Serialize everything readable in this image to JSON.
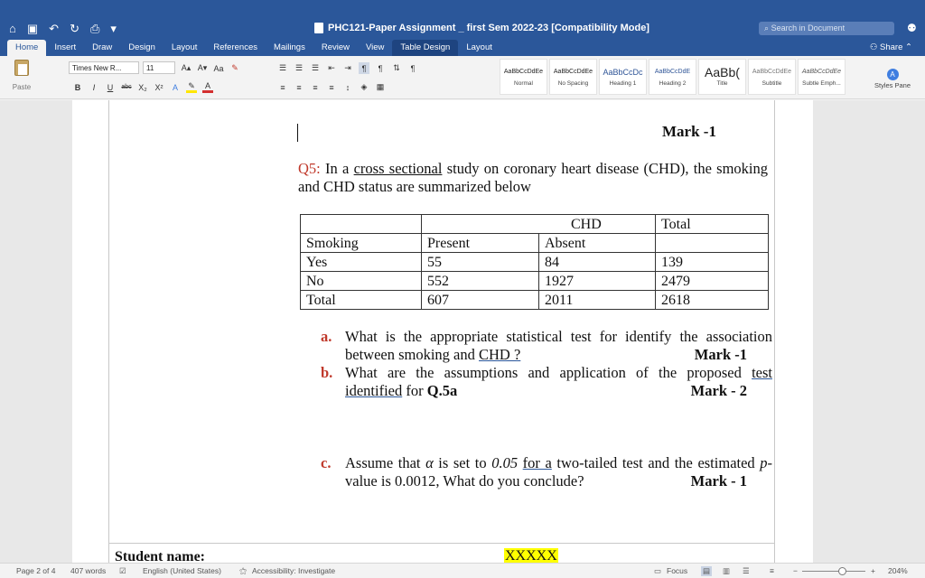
{
  "window": {
    "title": "PHC121-Paper Assignment _ first Sem 2022-23 [Compatibility Mode]",
    "search_placeholder": "Search in Document",
    "toolbar_icons": [
      "home-icon",
      "save-icon",
      "undo-icon",
      "redo-icon",
      "print-icon",
      "customize-icon"
    ]
  },
  "tabs": [
    "Home",
    "Insert",
    "Draw",
    "Design",
    "Layout",
    "References",
    "Mailings",
    "Review",
    "View",
    "Table Design",
    "Layout"
  ],
  "share_label": "Share",
  "ribbon": {
    "paste_label": "Paste",
    "font_name": "Times New R...",
    "font_size": "11",
    "styles": [
      {
        "sample": "AaBbCcDdEe",
        "name": "Normal"
      },
      {
        "sample": "AaBbCcDdEe",
        "name": "No Spacing"
      },
      {
        "sample": "AaBbCcDc",
        "name": "Heading 1"
      },
      {
        "sample": "AaBbCcDdE",
        "name": "Heading 2"
      },
      {
        "sample": "AaBb(",
        "name": "Title"
      },
      {
        "sample": "AaBbCcDdEe",
        "name": "Subtitle"
      },
      {
        "sample": "AaBbCcDdEe",
        "name": "Subtle Emph..."
      }
    ],
    "styles_pane_label": "Styles Pane"
  },
  "document": {
    "mark_top": "Mark -1",
    "q5_label": "Q5:",
    "q5_part1": " In a ",
    "q5_underlined": "cross sectional",
    "q5_part2": " study on coronary heart disease (CHD), the smoking and CHD status are summarized below",
    "table": {
      "header_chd": "CHD",
      "header_total": "Total",
      "col_smoking": "Smoking",
      "col_present": "Present",
      "col_absent": "Absent",
      "rows": [
        {
          "label": "Yes",
          "present": "55",
          "absent": "84",
          "total": "139"
        },
        {
          "label": "No",
          "present": "552",
          "absent": "1927",
          "total": "2479"
        },
        {
          "label": "Total",
          "present": "607",
          "absent": "2011",
          "total": "2618"
        }
      ]
    },
    "qa": {
      "letter": "a.",
      "text1": "What is the appropriate statistical test for identify the association between smoking and ",
      "text_ul": "CHD ?",
      "mark": "Mark -1"
    },
    "qb": {
      "letter": "b.",
      "text1": "What are the assumptions and application of the proposed ",
      "text_ul1": "test identified",
      "text2": " for ",
      "text_bold": "Q.5a",
      "mark": "Mark - 2"
    },
    "qc": {
      "letter": "c.",
      "text1": "Assume that ",
      "alpha": "α",
      "text2": " is set to ",
      "val": "0.05",
      "text_ul": "for  a",
      "text3": " two-tailed test and the estimated ",
      "pval": "p",
      "text4": "-value is 0.0012, What do you conclude?",
      "mark": "Mark - 1"
    },
    "student_label": "Student name:",
    "student_value": "XXXXX"
  },
  "status": {
    "page": "Page 2 of 4",
    "words": "407 words",
    "language": "English (United States)",
    "accessibility": "Accessibility: Investigate",
    "focus": "Focus",
    "zoom": "204%"
  }
}
